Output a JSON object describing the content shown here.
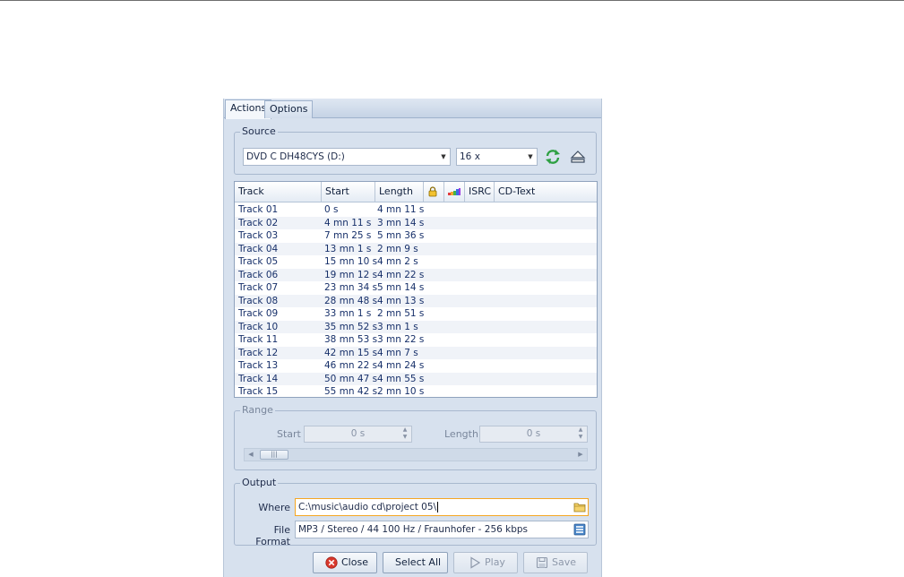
{
  "tabs": [
    {
      "label": "Actions",
      "active": true
    },
    {
      "label": "Options",
      "active": false
    }
  ],
  "source": {
    "label": "Source",
    "drive": "DVD C  DH48CYS (D:)",
    "speed": "16 x",
    "refresh_icon": "refresh-icon",
    "eject_icon": "eject-icon"
  },
  "track_list": {
    "columns": [
      "Track",
      "Start",
      "Length",
      "lock-icon",
      "color-bars-icon",
      "ISRC",
      "CD-Text"
    ],
    "headers": {
      "track": "Track",
      "start": "Start",
      "length": "Length",
      "isrc": "ISRC",
      "cdtext": "CD-Text"
    },
    "rows": [
      {
        "track": "Track 01",
        "start": "0 s",
        "length": "4 mn 11 s"
      },
      {
        "track": "Track 02",
        "start": "4 mn 11 s",
        "length": "3 mn 14 s"
      },
      {
        "track": "Track 03",
        "start": "7 mn 25 s",
        "length": "5 mn 36 s"
      },
      {
        "track": "Track 04",
        "start": "13 mn 1 s",
        "length": "2 mn 9 s"
      },
      {
        "track": "Track 05",
        "start": "15 mn 10 s",
        "length": "4 mn 2 s"
      },
      {
        "track": "Track 06",
        "start": "19 mn 12 s",
        "length": "4 mn 22 s"
      },
      {
        "track": "Track 07",
        "start": "23 mn 34 s",
        "length": "5 mn 14 s"
      },
      {
        "track": "Track 08",
        "start": "28 mn 48 s",
        "length": "4 mn 13 s"
      },
      {
        "track": "Track 09",
        "start": "33 mn 1 s",
        "length": "2 mn 51 s"
      },
      {
        "track": "Track 10",
        "start": "35 mn 52 s",
        "length": "3 mn 1 s"
      },
      {
        "track": "Track 11",
        "start": "38 mn 53 s",
        "length": "3 mn 22 s"
      },
      {
        "track": "Track 12",
        "start": "42 mn 15 s",
        "length": "4 mn 7 s"
      },
      {
        "track": "Track 13",
        "start": "46 mn 22 s",
        "length": "4 mn 24 s"
      },
      {
        "track": "Track 14",
        "start": "50 mn 47 s",
        "length": "4 mn 55 s"
      },
      {
        "track": "Track 15",
        "start": "55 mn 42 s",
        "length": "2 mn 10 s"
      }
    ]
  },
  "range": {
    "label": "Range",
    "start_label": "Start",
    "start_value": "0 s",
    "length_label": "Length",
    "length_value": "0 s"
  },
  "output": {
    "label": "Output",
    "where_label": "Where",
    "where_value": "C:\\music\\audio cd\\project 05\\",
    "format_label": "File Format",
    "format_value": "MP3 / Stereo / 44 100 Hz / Fraunhofer - 256 kbps"
  },
  "buttons": {
    "close": "Close",
    "select_all": "Select All",
    "play": "Play",
    "save": "Save"
  },
  "colors": {
    "panel_bg": "#d7e1ee",
    "focus_border": "#f5a623",
    "close_icon": "#d9382c",
    "refresh_icon": "#2ea043"
  }
}
